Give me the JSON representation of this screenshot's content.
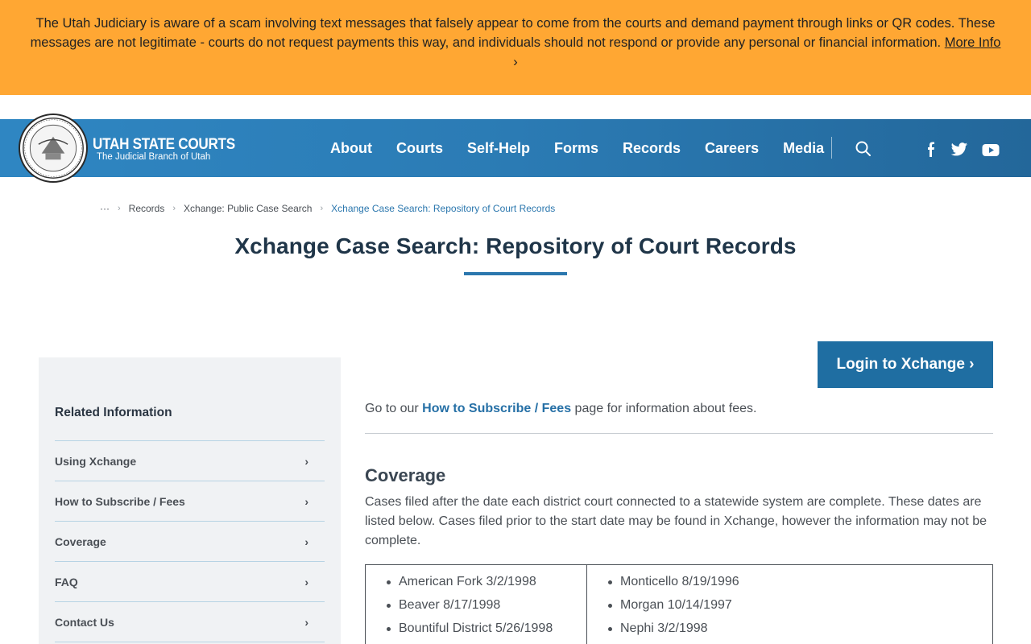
{
  "alert": {
    "message": "The Utah Judiciary is aware of a scam involving text messages that falsely appear to come from the courts and demand payment through links or QR codes. These messages are not legitimate - courts do not request payments this way, and individuals should not respond or provide any personal or financial information.",
    "link_label": "More Info",
    "chevron": "›"
  },
  "header": {
    "brand_title": "UTAH STATE COURTS",
    "brand_subtitle": "The Judicial Branch of Utah",
    "seal_icon": "utah-judiciary-seal",
    "nav": [
      "About",
      "Courts",
      "Self-Help",
      "Forms",
      "Records",
      "Careers",
      "Media"
    ],
    "icons": [
      "search-icon",
      "facebook-icon",
      "twitter-icon",
      "youtube-icon"
    ]
  },
  "breadcrumb": {
    "ellipsis": "···",
    "items": [
      "Records",
      "Xchange: Public Case Search"
    ],
    "current": "Xchange Case Search: Repository of Court Records",
    "separator": "›"
  },
  "page": {
    "title": "Xchange Case Search: Repository of Court Records",
    "login_label": "Login to Xchange",
    "login_chevron": "›",
    "intro_prefix": "Go to our",
    "intro_link": "How to Subscribe / Fees",
    "intro_suffix": "page for information about fees."
  },
  "sidebar": {
    "heading": "Related Information",
    "items": [
      "Using Xchange",
      "How to Subscribe / Fees",
      "Coverage",
      "FAQ",
      "Contact Us"
    ],
    "arrow": "›"
  },
  "coverage": {
    "heading": "Coverage",
    "paragraph": "Cases filed after the date each district court connected to a statewide system are complete. These dates are listed below. Cases filed prior to the start date may be found in Xchange, however the information may not be complete.",
    "col1": [
      "American Fork 3/2/1998",
      "Beaver 8/17/1998",
      "Bountiful District 5/26/1998"
    ],
    "col2": [
      "Monticello 8/19/1996",
      "Morgan 10/14/1997",
      "Nephi 3/2/1998"
    ]
  },
  "colors": {
    "alert_bg": "#ffa733",
    "header_blue": "#2b7bb4",
    "button_blue": "#1f6ea2",
    "link_blue": "#2670a6"
  }
}
